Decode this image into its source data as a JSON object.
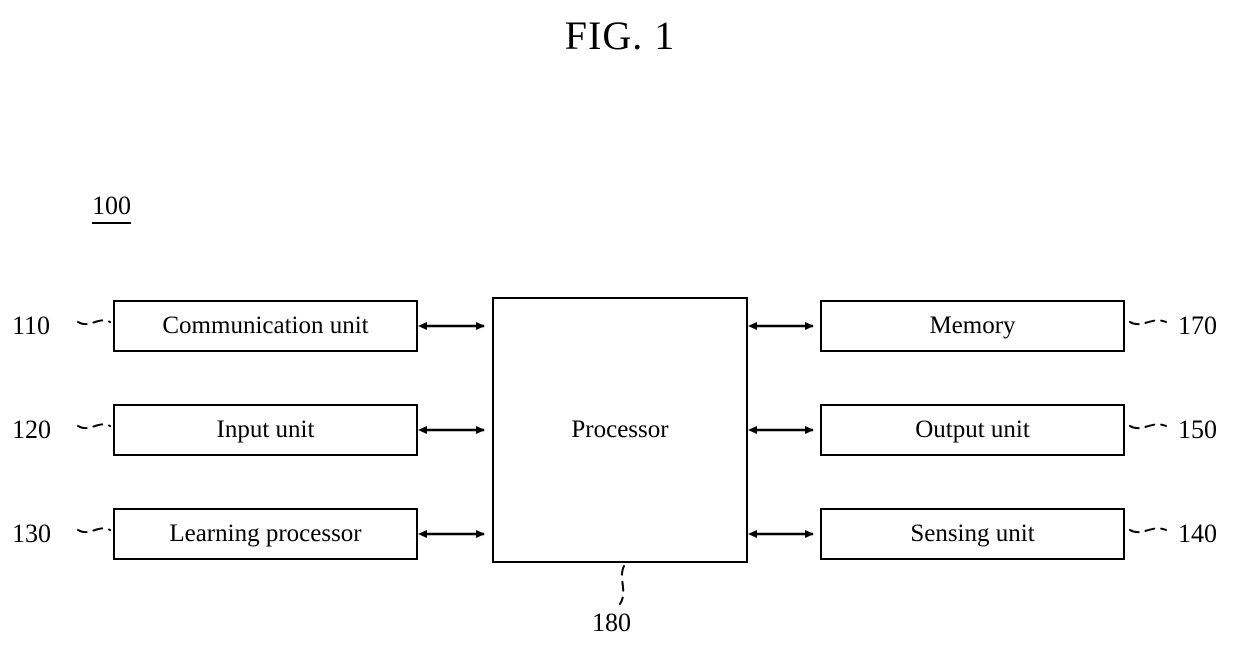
{
  "figure": {
    "title": "FIG. 1",
    "system_reference": "100",
    "processor_reference": "180"
  },
  "processor": {
    "label": "Processor",
    "reference": "180"
  },
  "left_blocks": [
    {
      "reference": "110",
      "label": "Communication unit"
    },
    {
      "reference": "120",
      "label": "Input unit"
    },
    {
      "reference": "130",
      "label": "Learning processor"
    }
  ],
  "right_blocks": [
    {
      "reference": "170",
      "label": "Memory"
    },
    {
      "reference": "150",
      "label": "Output unit"
    },
    {
      "reference": "140",
      "label": "Sensing unit"
    }
  ],
  "connections": [
    {
      "from": "Communication unit",
      "to": "Processor",
      "type": "bidirectional-arrow"
    },
    {
      "from": "Input unit",
      "to": "Processor",
      "type": "bidirectional-arrow"
    },
    {
      "from": "Learning processor",
      "to": "Processor",
      "type": "bidirectional-arrow"
    },
    {
      "from": "Processor",
      "to": "Memory",
      "type": "bidirectional-arrow"
    },
    {
      "from": "Processor",
      "to": "Output unit",
      "type": "bidirectional-arrow"
    },
    {
      "from": "Processor",
      "to": "Sensing unit",
      "type": "bidirectional-arrow"
    }
  ],
  "colors": {
    "background": "#ffffff",
    "stroke": "#000000",
    "text": "#000000"
  }
}
